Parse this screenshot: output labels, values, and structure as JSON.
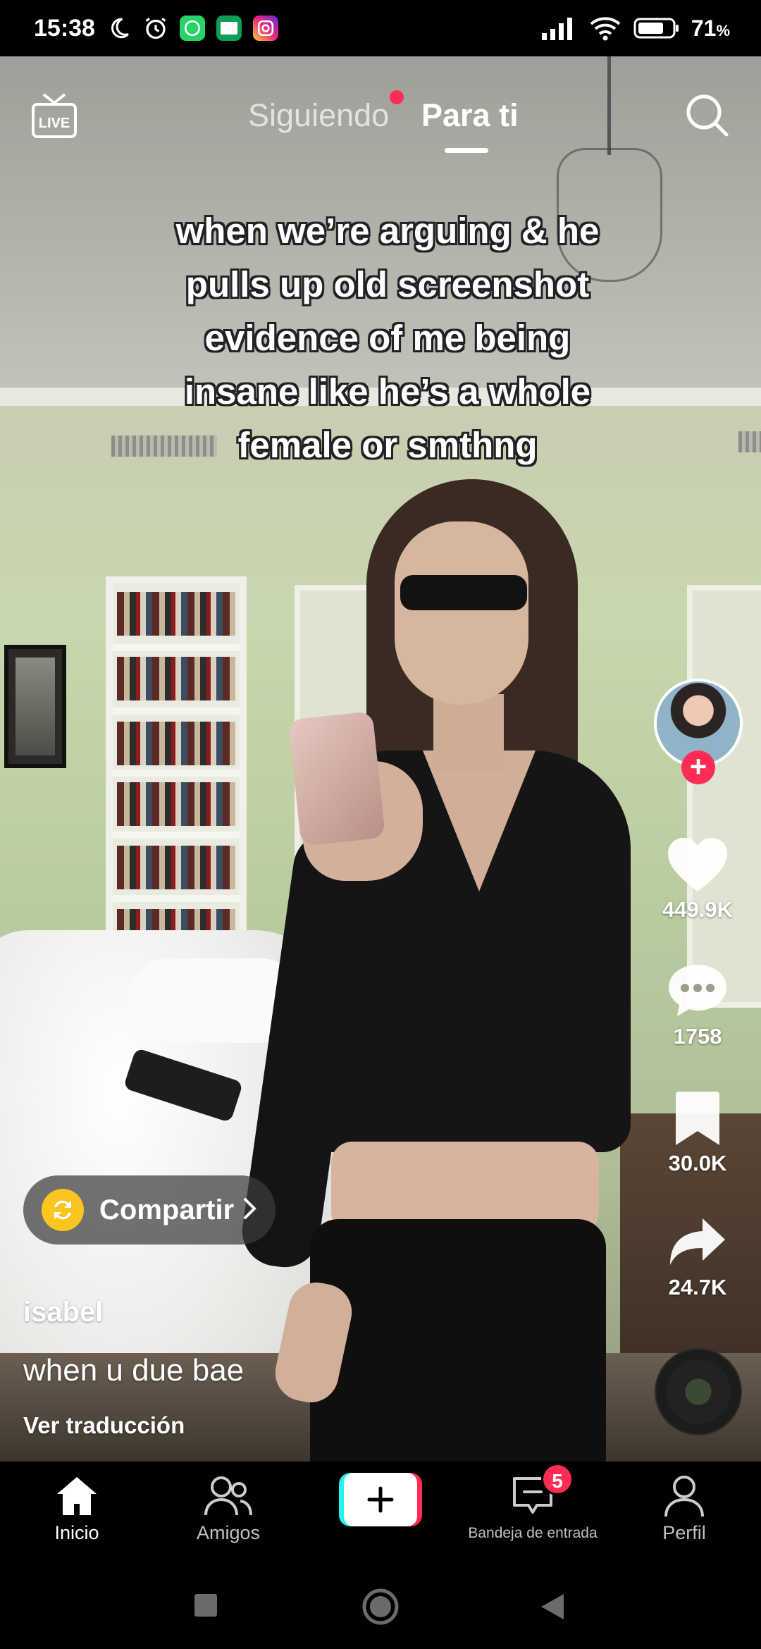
{
  "status_bar": {
    "time": "15:38",
    "battery_percent": "71",
    "battery_unit": "%",
    "icons": [
      "moon-icon",
      "alarm-icon",
      "whatsapp-icon",
      "classroom-icon",
      "instagram-icon",
      "signal-icon",
      "wifi-icon",
      "battery-icon"
    ]
  },
  "top_nav": {
    "tabs": [
      {
        "label": "Siguiendo",
        "active": false,
        "has_dot": true
      },
      {
        "label": "Para ti",
        "active": true
      }
    ],
    "live_icon": "live-icon",
    "search_icon": "search-icon"
  },
  "video": {
    "overlay_lines": [
      "when we’re arguing & he",
      "pulls up old screenshot",
      "evidence of me being",
      "insane like he’s a whole",
      "female or smthng"
    ],
    "author": "isabel",
    "description": "when u due bae",
    "translate_label": "Ver traducción"
  },
  "actions": {
    "likes": "449.9K",
    "comments": "1758",
    "saves": "30.0K",
    "shares": "24.7K"
  },
  "share_pill": {
    "label": "Compartir"
  },
  "bottom_nav": {
    "items": [
      {
        "label": "Inicio",
        "icon": "home-icon",
        "active": true
      },
      {
        "label": "Amigos",
        "icon": "friends-icon"
      },
      {
        "label": "",
        "icon": "create-icon"
      },
      {
        "label": "Bandeja de entrada",
        "icon": "inbox-icon",
        "badge": "5"
      },
      {
        "label": "Perfil",
        "icon": "profile-icon"
      }
    ]
  },
  "colors": {
    "accent_red": "#fe2c55",
    "accent_cyan": "#25f4ee",
    "share_yellow": "#fbc520"
  }
}
